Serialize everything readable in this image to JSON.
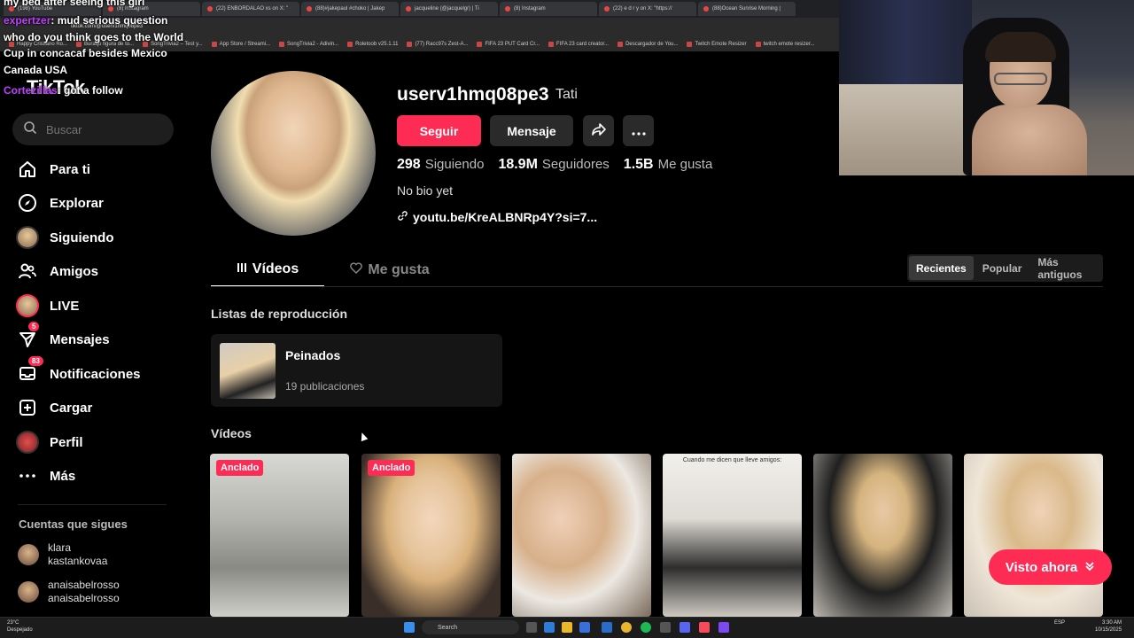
{
  "browser": {
    "tabs": [
      "(198) YouTube",
      "(8) Instagram",
      "(22) ENBORDALAO xs on X: \"",
      "(88)#jakepaul #choko | Jakep",
      "jacqueline (@jacquelgr) | Ti",
      "(8) Instagram",
      "(22) e d r y on X: \"https://",
      "(88)Ocean Sunrise Morning |"
    ],
    "url": "tiktok.com/@userv1hmq08pe3",
    "bookmarks": [
      "Happy Cristiano Ro...",
      "Buraqo figura de to...",
      "SongTrivia2 – Test y...",
      "App Store / Streami...",
      "SongTrivia2 - Adivin...",
      "Roletoob v25.1.11",
      "(77) Racc97s Zest-A...",
      "FIFA 23 PUT Card Cr...",
      "FIFA 23 card creator...",
      "Descargador de You...",
      "Twitch Emote Resizer",
      "twitch emote resizer..."
    ]
  },
  "chat": {
    "line1": "my bed after seeing this girl",
    "user2": "expertzer",
    "msg2": ": mud serious question",
    "line3": "who do you think goes to the World",
    "line4": "Cup in concacaf besides Mexico",
    "line5": "Canada USA",
    "user6": "Cortezillas",
    "msg6": ": got a follow"
  },
  "sidebar": {
    "logo": "TikTok",
    "search_placeholder": "Buscar",
    "items": [
      {
        "label": "Para ti",
        "icon": "home-icon"
      },
      {
        "label": "Explorar",
        "icon": "compass-icon"
      },
      {
        "label": "Siguiendo",
        "icon": "following-avatar-icon"
      },
      {
        "label": "Amigos",
        "icon": "friends-icon"
      },
      {
        "label": "LIVE",
        "icon": "live-avatar-icon"
      },
      {
        "label": "Mensajes",
        "icon": "send-icon",
        "badge": "5"
      },
      {
        "label": "Notificaciones",
        "icon": "inbox-icon",
        "badge": "83"
      },
      {
        "label": "Cargar",
        "icon": "upload-plus-icon"
      },
      {
        "label": "Perfil",
        "icon": "profile-avatar-icon"
      },
      {
        "label": "Más",
        "icon": "more-dots-icon"
      }
    ],
    "following_header": "Cuentas que sigues",
    "following": [
      {
        "name": "klara",
        "handle": "kastankovaa"
      },
      {
        "name": "anaisabelrosso",
        "handle": "anaisabelrosso"
      }
    ]
  },
  "profile": {
    "username": "userv1hmq08pe3",
    "nickname": "Tati",
    "follow_label": "Seguir",
    "message_label": "Mensaje",
    "stats": [
      {
        "value": "298",
        "label": "Siguiendo"
      },
      {
        "value": "18.9M",
        "label": "Seguidores"
      },
      {
        "value": "1.5B",
        "label": "Me gusta"
      }
    ],
    "bio": "No bio yet",
    "link": "youtu.be/KreALBNRp4Y?si=7..."
  },
  "tabs": {
    "videos": "Vídeos",
    "likes": "Me gusta"
  },
  "sort": [
    "Recientes",
    "Popular",
    "Más antiguos"
  ],
  "playlists": {
    "header": "Listas de reproducción",
    "items": [
      {
        "title": "Peinados",
        "count": "19 publicaciones"
      }
    ]
  },
  "videos": {
    "header": "Vídeos",
    "pinned_label": "Anclado",
    "caption4": "Cuando me dicen que lleve amigos:"
  },
  "visto": {
    "label": "Visto ahora"
  },
  "taskbar": {
    "weather_temp": "23°C",
    "weather_desc": "Despejado",
    "search": "Search",
    "lang": "ESP",
    "time": "3:30 AM",
    "date": "10/15/2025"
  },
  "colors": {
    "accent": "#fe2c55",
    "bg": "#000000"
  }
}
